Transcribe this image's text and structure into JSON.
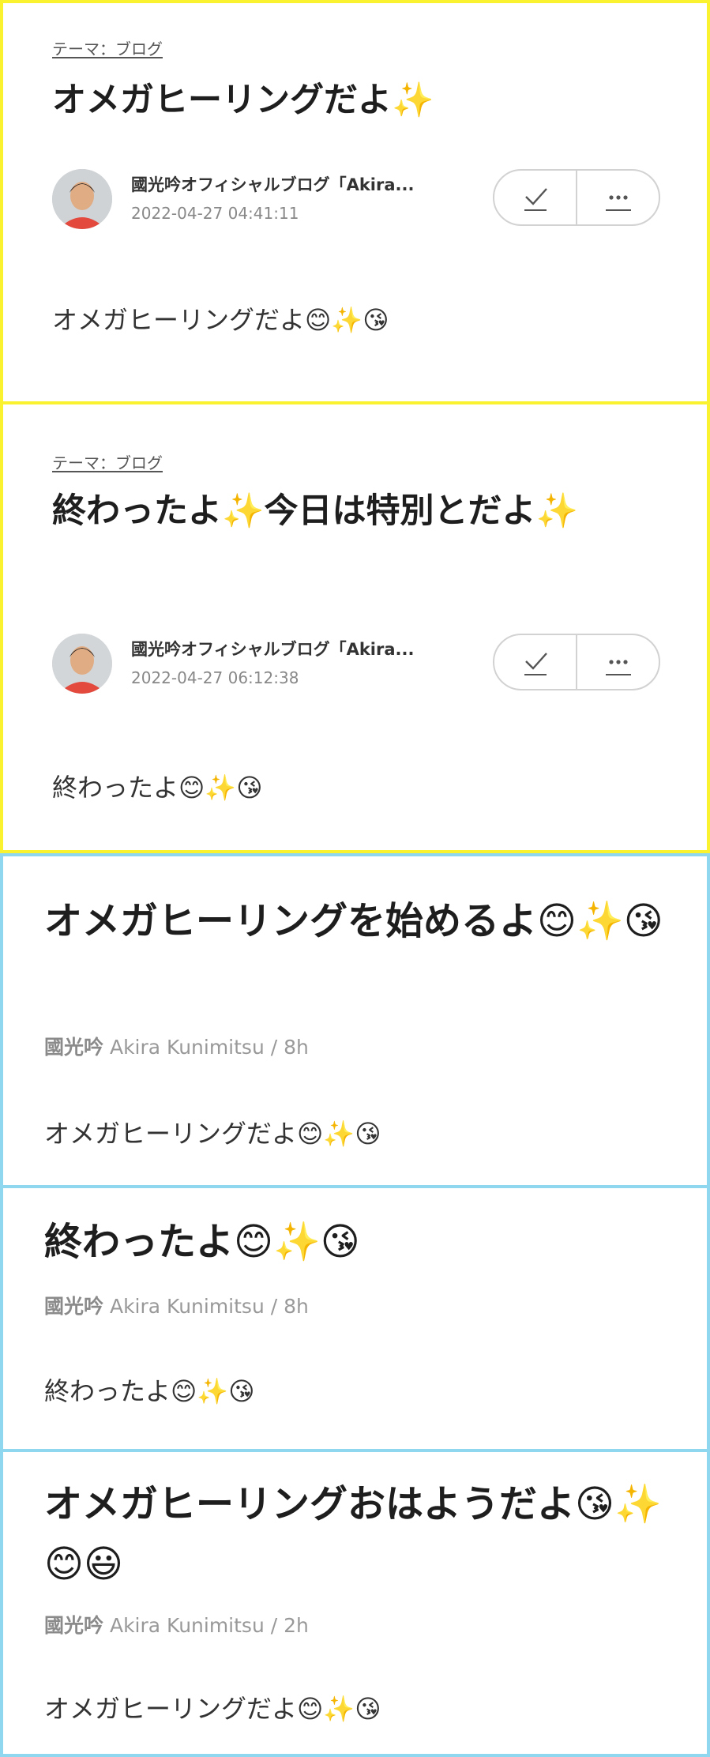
{
  "posts_yellow": [
    {
      "theme": "テーマ：ブログ",
      "title": "オメガヒーリングだよ✨",
      "author": "國光吟オフィシャルブログ「Akira...",
      "date": "2022-04-27 04:41:11",
      "body": "オメガヒーリングだよ😊✨😘"
    },
    {
      "theme": "テーマ：ブログ",
      "title": "終わったよ✨今日は特別とだよ✨",
      "author": "國光吟オフィシャルブログ「Akira...",
      "date": "2022-04-27 06:12:38",
      "body": "終わったよ😊✨😘"
    }
  ],
  "posts_blue": [
    {
      "title": "オメガヒーリングを始めるよ😊✨😘",
      "author_jp": "國光吟",
      "author_en": "Akira Kunimitsu",
      "time_sep": " / ",
      "time": "8h",
      "body": "オメガヒーリングだよ😊✨😘"
    },
    {
      "title": "終わったよ😊✨😘",
      "author_jp": "國光吟",
      "author_en": "Akira Kunimitsu",
      "time_sep": " / ",
      "time": "8h",
      "body": "終わったよ😊✨😘"
    },
    {
      "title": "オメガヒーリングおはようだよ😘✨😊😃",
      "author_jp": "國光吟",
      "author_en": "Akira Kunimitsu",
      "time_sep": " / ",
      "time": "2h",
      "body": "オメガヒーリングだよ😊✨😘"
    }
  ],
  "icons": {
    "check": "check-icon",
    "more": "more-icon",
    "avatar": "avatar"
  },
  "colors": {
    "yellow_border": "#fbf22f",
    "blue_border": "#8fd6ef",
    "text": "#222222",
    "muted": "#888888"
  }
}
